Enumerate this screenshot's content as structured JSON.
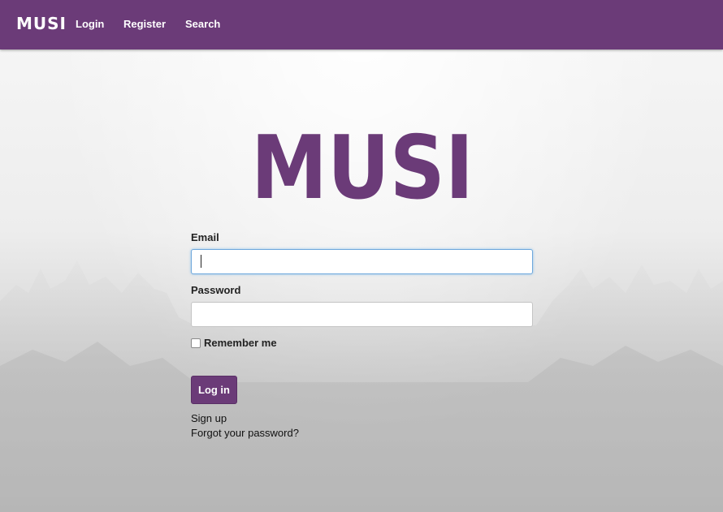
{
  "navbar": {
    "brand": "MUSI",
    "links": [
      "Login",
      "Register",
      "Search"
    ],
    "color": "#6b3b78"
  },
  "logo": {
    "text": "MUSI",
    "color": "#6b3b78"
  },
  "form": {
    "email_label": "Email",
    "email_value": "",
    "password_label": "Password",
    "password_value": "",
    "remember_label": "Remember me",
    "remember_checked": false,
    "submit_label": "Log in"
  },
  "links": {
    "signup": "Sign up",
    "forgot": "Forgot your password?"
  },
  "accent_color": "#6b3b78",
  "focus_color": "#6fa8dc"
}
